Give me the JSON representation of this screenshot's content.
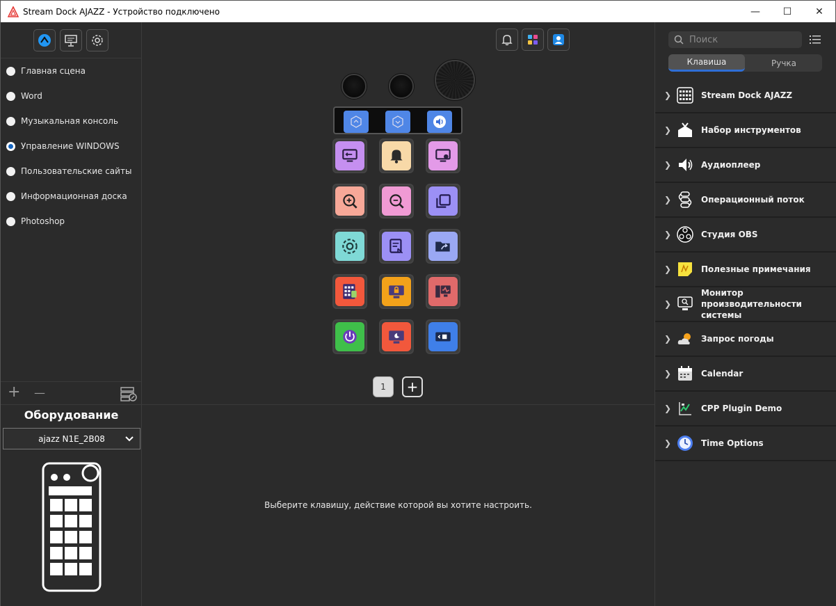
{
  "window": {
    "title": "Stream Dock AJAZZ - Устройство подключено",
    "minimize": "—",
    "maximize": "☐",
    "close": "✕"
  },
  "scenes": [
    {
      "label": "Главная сцена",
      "selected": false
    },
    {
      "label": "Word",
      "selected": false
    },
    {
      "label": "Музыкальная консоль",
      "selected": false
    },
    {
      "label": "Управление WINDOWS",
      "selected": true
    },
    {
      "label": "Пользовательские сайты",
      "selected": false
    },
    {
      "label": "Информационная доска",
      "selected": false
    },
    {
      "label": "Photoshop",
      "selected": false
    }
  ],
  "scene_tools": {
    "add": "+",
    "remove": "—"
  },
  "hardware": {
    "title": "Оборудование",
    "device": "ajazz N1E_2B08"
  },
  "pager": {
    "current_page": "1",
    "add": "+"
  },
  "hint": "Выберите клавишу, действие которой вы хотите настроить.",
  "search": {
    "placeholder": "Поиск"
  },
  "tabs": [
    {
      "label": "Клавиша",
      "active": true
    },
    {
      "label": "Ручка",
      "active": false
    }
  ],
  "plugins": [
    {
      "label": "Stream Dock AJAZZ",
      "icon": "keyboard-icon"
    },
    {
      "label": "Набор инструментов",
      "icon": "toolkit-icon"
    },
    {
      "label": "Аудиоплеер",
      "icon": "speaker-icon"
    },
    {
      "label": "Операционный поток",
      "icon": "workflow-icon"
    },
    {
      "label": "Студия OBS",
      "icon": "obs-icon"
    },
    {
      "label": "Полезные примечания",
      "icon": "sticky-note-icon"
    },
    {
      "label": "Монитор производительности системы",
      "icon": "performance-monitor-icon"
    },
    {
      "label": "Запрос погоды",
      "icon": "weather-icon"
    },
    {
      "label": "Calendar",
      "icon": "calendar-icon"
    },
    {
      "label": "CPP Plugin Demo",
      "icon": "cpp-demo-icon"
    },
    {
      "label": "Time Options",
      "icon": "clock-icon"
    }
  ],
  "keys": [
    {
      "name": "desktop-back-icon",
      "color": "#c58ff0"
    },
    {
      "name": "bell-icon",
      "color": "#f8d9a8"
    },
    {
      "name": "screen-settings-icon",
      "color": "#e39ae8"
    },
    {
      "name": "zoom-in-icon",
      "color": "#f7a898"
    },
    {
      "name": "zoom-out-icon",
      "color": "#f09ad4"
    },
    {
      "name": "copy-window-icon",
      "color": "#9c90f5"
    },
    {
      "name": "gear-icon",
      "color": "#7fd9d6"
    },
    {
      "name": "document-edit-icon",
      "color": "#9c90f5"
    },
    {
      "name": "folder-open-icon",
      "color": "#9aa8f3"
    },
    {
      "name": "calculator-icon",
      "color": "#f2583c"
    },
    {
      "name": "lock-screen-icon",
      "color": "#f3a21a"
    },
    {
      "name": "system-monitor-icon",
      "color": "#e06a6a"
    },
    {
      "name": "power-icon",
      "color": "#3fbf4a"
    },
    {
      "name": "sleep-icon",
      "color": "#f2583c"
    },
    {
      "name": "dev-tools-icon",
      "color": "#3f7fe9"
    }
  ],
  "colors": {
    "accent": "#2f6fd6",
    "background": "#2b2b2b"
  }
}
